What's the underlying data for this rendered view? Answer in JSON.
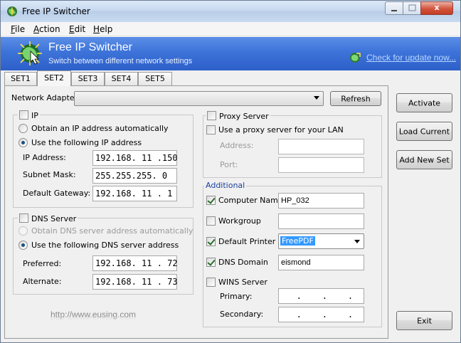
{
  "window": {
    "title": "Free IP Switcher",
    "close_glyph": "x"
  },
  "menu": {
    "items": [
      {
        "accel": "F",
        "rest": "ile"
      },
      {
        "accel": "A",
        "rest": "ction"
      },
      {
        "accel": "E",
        "rest": "dit"
      },
      {
        "accel": "H",
        "rest": "elp"
      }
    ]
  },
  "banner": {
    "title": "Free IP Switcher",
    "subtitle": "Switch between different network settings",
    "update_link": "Check for update now...",
    "bg_color": "#3d73d9"
  },
  "tabs": [
    {
      "label": "SET1",
      "active": false
    },
    {
      "label": "SET2",
      "active": true
    },
    {
      "label": "SET3",
      "active": false
    },
    {
      "label": "SET4",
      "active": false
    },
    {
      "label": "SET5",
      "active": false
    }
  ],
  "adapter": {
    "label": "Network Adapter:",
    "value": "",
    "refresh_label": "Refresh"
  },
  "ip": {
    "group_label": "IP",
    "checked": false,
    "auto_label": "Obtain an IP address automatically",
    "auto_selected": false,
    "manual_label": "Use the following IP address",
    "manual_selected": true,
    "address_label": "IP Address:",
    "address": "192.168. 11 .150",
    "mask_label": "Subnet Mask:",
    "mask": "255.255.255. 0",
    "gateway_label": "Default Gateway:",
    "gateway": "192.168. 11 . 1"
  },
  "dns": {
    "group_label": "DNS Server",
    "checked": false,
    "auto_label": "Obtain DNS server address automatically",
    "auto_selected": false,
    "manual_label": "Use the following DNS server address",
    "manual_selected": true,
    "preferred_label": "Preferred:",
    "preferred": "192.168. 11 . 72",
    "alternate_label": "Alternate:",
    "alternate": "192.168. 11 . 73"
  },
  "proxy": {
    "group_label": "Proxy Server",
    "checked": false,
    "use_label": "Use a proxy server for your LAN",
    "use_checked": false,
    "address_label": "Address:",
    "address": "",
    "port_label": "Port:",
    "port": ""
  },
  "additional": {
    "group_label": "Additional",
    "computer_name_label": "Computer Name",
    "computer_name_checked": true,
    "computer_name": "HP_032",
    "workgroup_label": "Workgroup",
    "workgroup_checked": false,
    "workgroup": "",
    "printer_label": "Default Printer",
    "printer_checked": true,
    "printer": "FreePDF",
    "dns_domain_label": "DNS Domain",
    "dns_domain_checked": true,
    "dns_domain": "eismond",
    "wins_label": "WINS Server",
    "wins_checked": false,
    "primary_label": "Primary:",
    "primary": "   .    .    .",
    "secondary_label": "Secondary:",
    "secondary": "   .    .    ."
  },
  "actions": {
    "activate": "Activate",
    "load_current": "Load Current",
    "add_new_set": "Add New Set",
    "exit": "Exit"
  },
  "watermark": "http://www.eusing.com",
  "colors": {
    "selection": "#3399ff",
    "link": "#b9d7ff"
  }
}
